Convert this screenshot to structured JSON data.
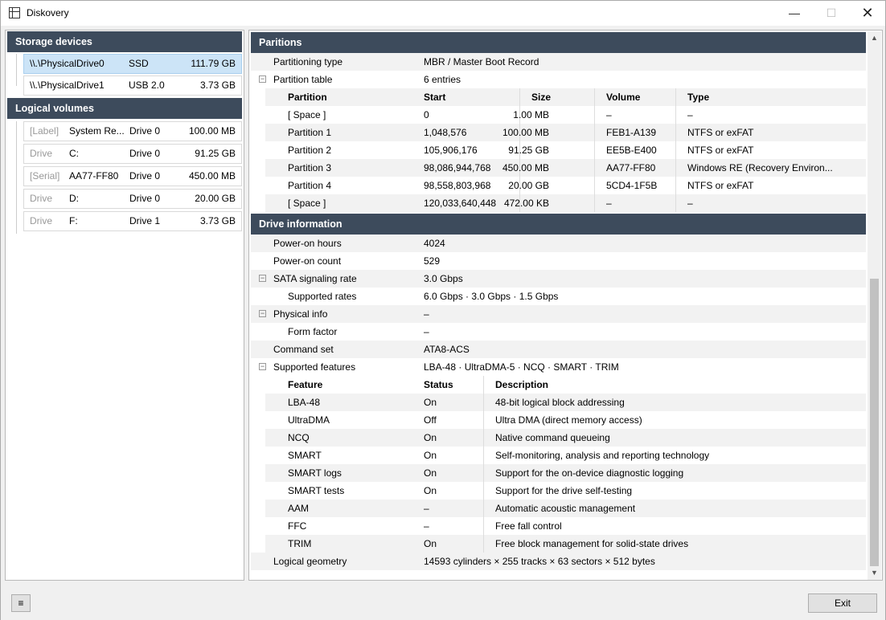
{
  "window": {
    "title": "Diskovery",
    "minimize": "—",
    "maximize": "☐",
    "close": "✕"
  },
  "left": {
    "storage_header": "Storage devices",
    "devices": [
      {
        "path": "\\\\.\\PhysicalDrive0",
        "type": "SSD",
        "size": "111.79 GB"
      },
      {
        "path": "\\\\.\\PhysicalDrive1",
        "type": "USB 2.0",
        "size": "3.73 GB"
      }
    ],
    "volumes_header": "Logical volumes",
    "volumes": [
      {
        "kind": "[Label]",
        "name": "System Re...",
        "drive": "Drive 0",
        "size": "100.00 MB"
      },
      {
        "kind": "Drive",
        "name": "C:",
        "drive": "Drive 0",
        "size": "91.25 GB"
      },
      {
        "kind": "[Serial]",
        "name": "AA77-FF80",
        "drive": "Drive 0",
        "size": "450.00 MB"
      },
      {
        "kind": "Drive",
        "name": "D:",
        "drive": "Drive 0",
        "size": "20.00 GB"
      },
      {
        "kind": "Drive",
        "name": "F:",
        "drive": "Drive 1",
        "size": "3.73 GB"
      }
    ]
  },
  "partitions": {
    "header": "Paritions",
    "type_label": "Partitioning type",
    "type_value": "MBR / Master Boot Record",
    "table_label": "Partition table",
    "table_value": "6 entries",
    "columns": [
      "Partition",
      "Start",
      "Size",
      "Volume",
      "Type"
    ],
    "rows": [
      [
        "[ Space ]",
        "0",
        "1.00 MB",
        "–",
        "–"
      ],
      [
        "Partition 1",
        "1,048,576",
        "100.00 MB",
        "FEB1-A139",
        "NTFS or exFAT"
      ],
      [
        "Partition 2",
        "105,906,176",
        "91.25 GB",
        "EE5B-E400",
        "NTFS or exFAT"
      ],
      [
        "Partition 3",
        "98,086,944,768",
        "450.00 MB",
        "AA77-FF80",
        "Windows RE (Recovery Environ..."
      ],
      [
        "Partition 4",
        "98,558,803,968",
        "20.00 GB",
        "5CD4-1F5B",
        "NTFS or exFAT"
      ],
      [
        "[ Space ]",
        "120,033,640,448",
        "472.00 KB",
        "–",
        "–"
      ]
    ]
  },
  "drive": {
    "header": "Drive information",
    "props": [
      {
        "label": "Power-on hours",
        "value": "4024",
        "toggle": ""
      },
      {
        "label": "Power-on count",
        "value": "529",
        "toggle": ""
      },
      {
        "label": "SATA signaling rate",
        "value": "3.0 Gbps",
        "toggle": "−"
      },
      {
        "label": "Supported rates",
        "value": "6.0 Gbps · 3.0 Gbps · 1.5 Gbps",
        "toggle": "",
        "child": true
      },
      {
        "label": "Physical info",
        "value": "–",
        "toggle": "−"
      },
      {
        "label": "Form factor",
        "value": "–",
        "toggle": "",
        "child": true
      },
      {
        "label": "Command set",
        "value": "ATA8-ACS",
        "toggle": ""
      },
      {
        "label": "Supported features",
        "value": "LBA-48 · UltraDMA-5 · NCQ · SMART · TRIM",
        "toggle": "−"
      }
    ],
    "feature_columns": [
      "Feature",
      "Status",
      "Description"
    ],
    "features": [
      [
        "LBA-48",
        "On",
        "48-bit logical block addressing"
      ],
      [
        "UltraDMA",
        "Off",
        "Ultra DMA (direct memory access)"
      ],
      [
        "NCQ",
        "On",
        "Native command queueing"
      ],
      [
        "SMART",
        "On",
        "Self-monitoring, analysis and reporting technology"
      ],
      [
        "SMART logs",
        "On",
        "Support for the on-device diagnostic logging"
      ],
      [
        "SMART tests",
        "On",
        "Support for the drive self-testing"
      ],
      [
        "AAM",
        "–",
        "Automatic acoustic management"
      ],
      [
        "FFC",
        "–",
        "Free fall control"
      ],
      [
        "TRIM",
        "On",
        "Free block management for solid-state drives"
      ]
    ],
    "geometry_label": "Logical geometry",
    "geometry_value": "14593 cylinders × 255 tracks × 63 sectors × 512 bytes"
  },
  "bottom": {
    "menu": "≡",
    "exit": "Exit"
  }
}
